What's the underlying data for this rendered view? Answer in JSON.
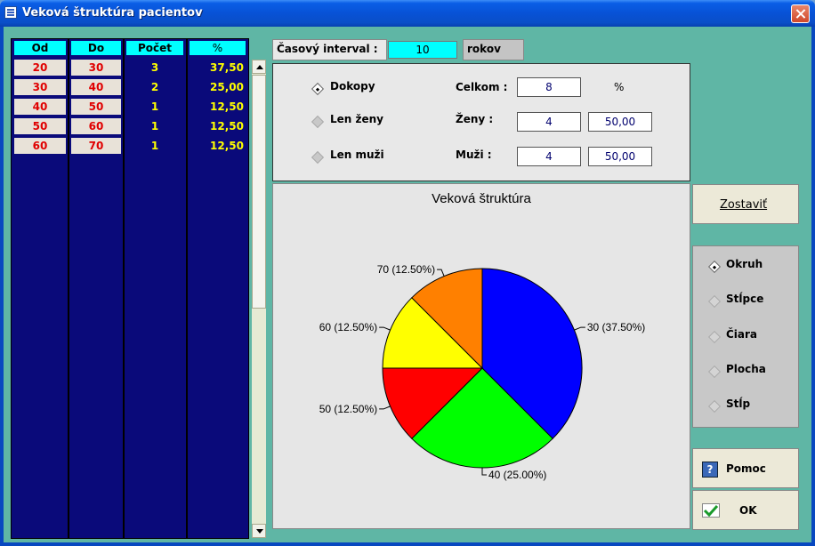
{
  "window": {
    "title": "Veková štruktúra pacientov"
  },
  "table": {
    "headers": [
      "Od",
      "Do",
      "Počet",
      "%"
    ],
    "rows": [
      {
        "od": "20",
        "do": "30",
        "pocet": "3",
        "pct": "37,50"
      },
      {
        "od": "30",
        "do": "40",
        "pocet": "2",
        "pct": "25,00"
      },
      {
        "od": "40",
        "do": "50",
        "pocet": "1",
        "pct": "12,50"
      },
      {
        "od": "50",
        "do": "60",
        "pocet": "1",
        "pct": "12,50"
      },
      {
        "od": "60",
        "do": "70",
        "pocet": "1",
        "pct": "12,50"
      }
    ]
  },
  "interval": {
    "label": "Časový interval :",
    "value": "10",
    "unit": "rokov"
  },
  "filters": {
    "options": [
      {
        "label": "Dokopy",
        "selected": true
      },
      {
        "label": "Len ženy",
        "selected": false
      },
      {
        "label": "Len muži",
        "selected": false
      }
    ],
    "celkom_label": "Celkom :",
    "celkom_value": "8",
    "pct_label": "%",
    "zeny_label": "Ženy :",
    "zeny_value": "4",
    "zeny_pct": "50,00",
    "muzi_label": "Muži :",
    "muzi_value": "4",
    "muzi_pct": "50,00"
  },
  "buttons": {
    "zostavit": "Zostaviť",
    "pomoc": "Pomoc",
    "ok": "OK"
  },
  "chart_types": [
    {
      "label": "Okruh",
      "selected": true
    },
    {
      "label": "Stĺpce",
      "selected": false
    },
    {
      "label": "Čiara",
      "selected": false
    },
    {
      "label": "Plocha",
      "selected": false
    },
    {
      "label": "Stĺp",
      "selected": false
    }
  ],
  "chart_data": {
    "type": "pie",
    "title": "Veková štruktúra",
    "slices": [
      {
        "label": "30 (37.50%)",
        "value": 37.5,
        "color": "#0000ff"
      },
      {
        "label": "40 (25.00%)",
        "value": 25.0,
        "color": "#00ff00"
      },
      {
        "label": "50 (12.50%)",
        "value": 12.5,
        "color": "#ff0000"
      },
      {
        "label": "60 (12.50%)",
        "value": 12.5,
        "color": "#ffff00"
      },
      {
        "label": "70 (12.50%)",
        "value": 12.5,
        "color": "#ff8000"
      }
    ]
  }
}
